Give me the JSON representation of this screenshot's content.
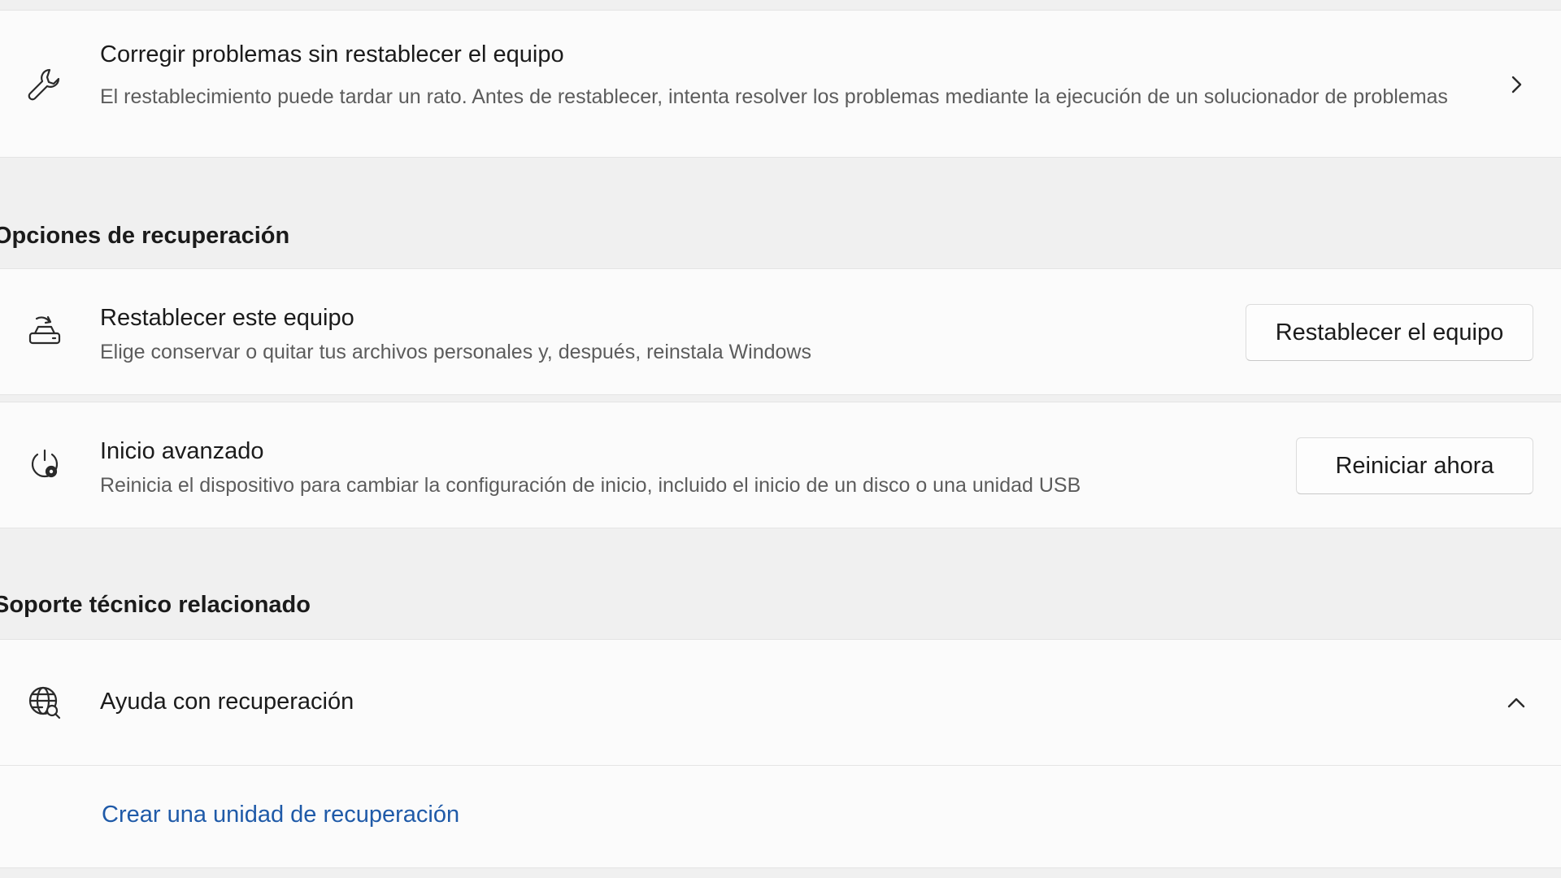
{
  "troubleshoot": {
    "title": "Corregir problemas sin restablecer el equipo",
    "description": "El restablecimiento puede tardar un rato. Antes de restablecer, intenta resolver los problemas mediante la ejecución de un solucionador de problemas",
    "icon": "wrench-icon"
  },
  "recovery_section": {
    "header": "Opciones de recuperación",
    "reset": {
      "title": "Restablecer este equipo",
      "description": "Elige conservar o quitar tus archivos personales y, después, reinstala Windows",
      "button": "Restablecer el equipo",
      "icon": "reset-pc-icon"
    },
    "advanced_start": {
      "title": "Inicio avanzado",
      "description": "Reinicia el dispositivo para cambiar la configuración de inicio, incluido el inicio de un disco o una unidad USB",
      "button": "Reiniciar ahora",
      "icon": "power-gear-icon"
    }
  },
  "support_section": {
    "header": "Soporte técnico relacionado",
    "help": {
      "title": "Ayuda con recuperación",
      "icon": "globe-search-icon",
      "expanded": true
    },
    "link": "Crear una unidad de recuperación"
  },
  "colors": {
    "background": "#f0f0f0",
    "card": "#fbfbfb",
    "link": "#1f5aa8",
    "secondary_text": "#5c5c5c"
  }
}
